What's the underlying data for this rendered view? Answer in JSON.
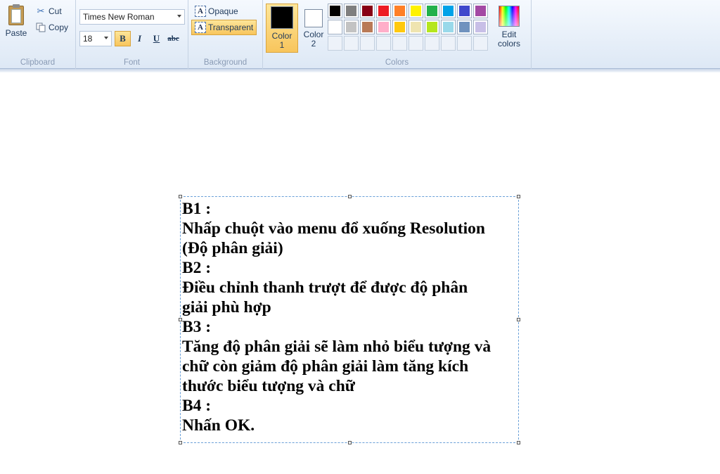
{
  "clipboard": {
    "paste_label": "Paste",
    "cut_label": "Cut",
    "copy_label": "Copy",
    "group_label": "Clipboard"
  },
  "font": {
    "family": "Times New Roman",
    "size": "18",
    "bold_label": "B",
    "italic_label": "I",
    "underline_label": "U",
    "strike_label": "abc",
    "bold_active": true,
    "group_label": "Font"
  },
  "background": {
    "opaque_label": "Opaque",
    "transparent_label": "Transparent",
    "selected": "Transparent",
    "group_label": "Background"
  },
  "colors": {
    "color1_label_a": "Color",
    "color1_label_b": "1",
    "color2_label_a": "Color",
    "color2_label_b": "2",
    "color1": "#000000",
    "color2": "#ffffff",
    "edit_label_a": "Edit",
    "edit_label_b": "colors",
    "group_label": "Colors",
    "palette_row1": [
      "#000000",
      "#7f7f7f",
      "#880015",
      "#ed1c24",
      "#ff7f27",
      "#fff200",
      "#22b14c",
      "#00a2e8",
      "#3f48cc",
      "#a349a4"
    ],
    "palette_row2": [
      "#ffffff",
      "#c3c3c3",
      "#b97a57",
      "#ffaec9",
      "#ffc90e",
      "#efe4b0",
      "#b5e61d",
      "#99d9ea",
      "#7092be",
      "#c8bfe7"
    ]
  },
  "canvas": {
    "lines": [
      "B1 :",
      "Nhấp chuột vào menu đổ xuống Resolution",
      "(Độ phân giải)",
      "B2 :",
      "Điều chỉnh thanh trượt để được độ phân",
      "giải phù hợp",
      "B3 :",
      "Tăng độ phân giải sẽ làm nhỏ biểu tượng và",
      "chữ còn giảm độ phân giải làm tăng kích",
      "thước biểu tượng và chữ",
      "B4 :",
      "Nhấn OK."
    ]
  }
}
